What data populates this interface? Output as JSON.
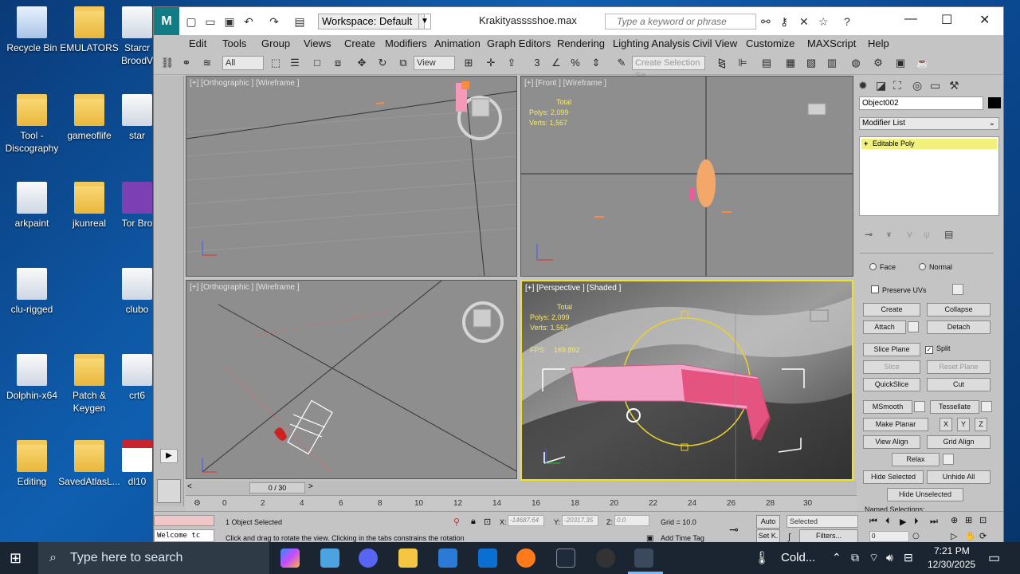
{
  "desktop": {
    "icons": [
      {
        "label": "Recycle Bin",
        "icon": "recycle-bin-icon"
      },
      {
        "label": "EMULATORS",
        "icon": "folder-icon"
      },
      {
        "label": "Starcr BroodV",
        "icon": "app-icon"
      },
      {
        "label": "Tool - Discography",
        "icon": "folder-icon"
      },
      {
        "label": "gameoflife",
        "icon": "folder-icon"
      },
      {
        "label": "star",
        "icon": "app-icon"
      },
      {
        "label": "arkpaint",
        "icon": "app-icon"
      },
      {
        "label": "jkunreal",
        "icon": "folder-icon"
      },
      {
        "label": "Tor Bro",
        "icon": "app-icon"
      },
      {
        "label": "clu-rigged",
        "icon": "file-icon"
      },
      {
        "label": "clubo",
        "icon": "file-icon"
      },
      {
        "label": "Dolphin-x64",
        "icon": "app-icon"
      },
      {
        "label": "Patch & Keygen",
        "icon": "folder-icon"
      },
      {
        "label": "crt6",
        "icon": "app-icon"
      },
      {
        "label": "Editing",
        "icon": "folder-icon"
      },
      {
        "label": "SavedAtlasL...",
        "icon": "folder-icon"
      },
      {
        "label": "dl10",
        "icon": "pdf-icon"
      }
    ]
  },
  "window": {
    "logo": "M",
    "workspace": "Workspace: Default",
    "file_title": "Krakityasssshoe.max",
    "search_placeholder": "Type a keyword or phrase"
  },
  "menu": [
    "Edit",
    "Tools",
    "Group",
    "Views",
    "Create",
    "Modifiers",
    "Animation",
    "Graph Editors",
    "Rendering",
    "Lighting Analysis",
    "Civil View",
    "Customize",
    "MAXScript",
    "Help"
  ],
  "toolbar": {
    "filter": "All",
    "view": "View",
    "selection_set_placeholder": "Create Selection Se"
  },
  "viewports": {
    "top_left": {
      "label": "[+] [Orthographic ] [Wireframe ]"
    },
    "top_right": {
      "label": "[+] [Front ] [Wireframe ]",
      "stats_total": "Total",
      "polys_label": "Polys:",
      "polys": "2,099",
      "verts_label": "Verts:",
      "verts": "1,567"
    },
    "bottom_left": {
      "label": "[+] [Orthographic ] [Wireframe ]"
    },
    "bottom_right": {
      "label": "[+] [Perspective ] [Shaded ]",
      "stats_total": "Total",
      "polys_label": "Polys:",
      "polys": "2,099",
      "verts_label": "Verts:",
      "verts": "1,567",
      "fps_label": "FPS:",
      "fps": "169.892"
    }
  },
  "command_panel": {
    "object_name": "Object002",
    "modifier_list": "Modifier List",
    "stack_item": "Editable Poly",
    "face": "Face",
    "normal": "Normal",
    "preserve_uvs": "Preserve UVs",
    "create": "Create",
    "collapse": "Collapse",
    "attach": "Attach",
    "detach": "Detach",
    "slice_plane": "Slice Plane",
    "split": "Split",
    "slice": "Slice",
    "reset_plane": "Reset Plane",
    "quickslice": "QuickSlice",
    "cut": "Cut",
    "msmooth": "MSmooth",
    "tessellate": "Tessellate",
    "make_planar": "Make Planar",
    "x": "X",
    "y": "Y",
    "z": "Z",
    "view_align": "View Align",
    "grid_align": "Grid Align",
    "relax": "Relax",
    "hide_selected": "Hide Selected",
    "unhide_all": "Unhide All",
    "hide_unselected": "Hide Unselected",
    "named_selections": "Named Selections:"
  },
  "timeline": {
    "frame": "0 / 30",
    "ticks": [
      "0",
      "2",
      "4",
      "6",
      "8",
      "10",
      "12",
      "14",
      "16",
      "18",
      "20",
      "22",
      "24",
      "26",
      "28",
      "30"
    ]
  },
  "status": {
    "selected": "1 Object Selected",
    "prompt": "Click and drag to rotate the view.  Clicking in the tabs constrains the rotation",
    "welcome": "Welcome tc",
    "x_label": "X:",
    "x_value": "-14687.64",
    "y_label": "Y:",
    "y_value": "-20317.35",
    "z_label": "Z:",
    "z_value": "0.0",
    "grid": "Grid = 10.0",
    "add_time_tag": "Add Time Tag",
    "auto": "Auto",
    "set_k": "Set K.",
    "selected_dd": "Selected",
    "filters": "Filters...",
    "frame_field": "0"
  },
  "taskbar": {
    "search_placeholder": "Type here to search",
    "weather": "Cold...",
    "time": "7:21 PM",
    "date": "12/30/2025"
  }
}
